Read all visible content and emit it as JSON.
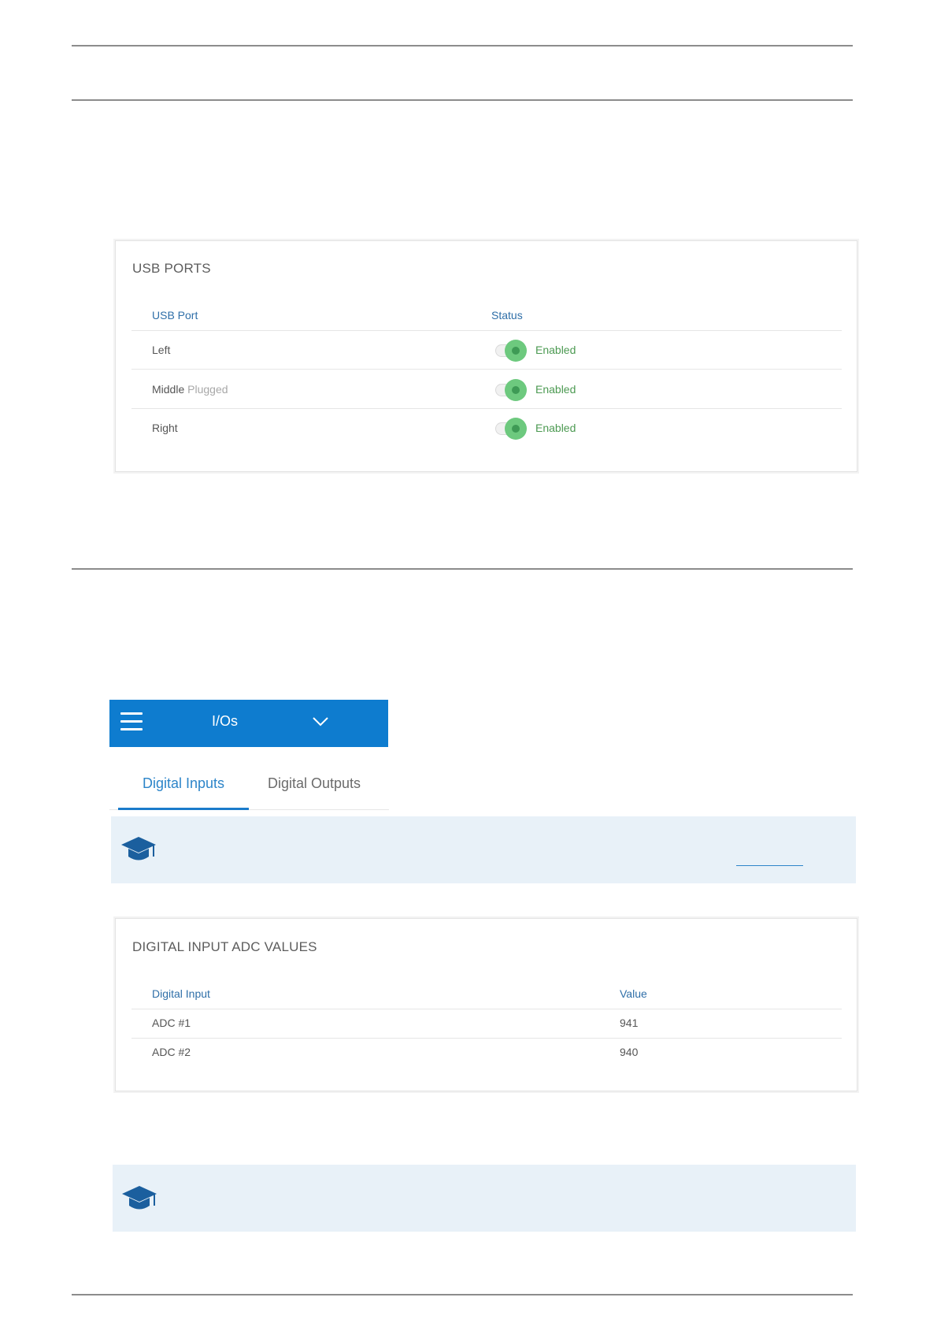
{
  "usb_ports": {
    "title": "USB PORTS",
    "headers": {
      "port": "USB Port",
      "status": "Status"
    },
    "rows": [
      {
        "name": "Left",
        "note": "",
        "status": "Enabled"
      },
      {
        "name": "Middle",
        "note": "Plugged",
        "status": "Enabled"
      },
      {
        "name": "Right",
        "note": "",
        "status": "Enabled"
      }
    ]
  },
  "io_header": {
    "title": "I/Os",
    "menu_icon": "hamburger-menu-icon",
    "dropdown_icon": "chevron-down-icon"
  },
  "tabs": [
    {
      "label": "Digital Inputs",
      "active": true
    },
    {
      "label": "Digital Outputs",
      "active": false
    }
  ],
  "tip_icon": "graduation-cap-icon",
  "adc": {
    "title": "DIGITAL INPUT ADC VALUES",
    "headers": {
      "input": "Digital Input",
      "value": "Value"
    },
    "rows": [
      {
        "name": "ADC #1",
        "value": "941"
      },
      {
        "name": "ADC #2",
        "value": "940"
      }
    ]
  },
  "colors": {
    "accent": "#0e7ccf",
    "header_text": "#2f6fa8",
    "enabled_green": "#4c9a52",
    "tip_background": "#e8f1f8"
  }
}
